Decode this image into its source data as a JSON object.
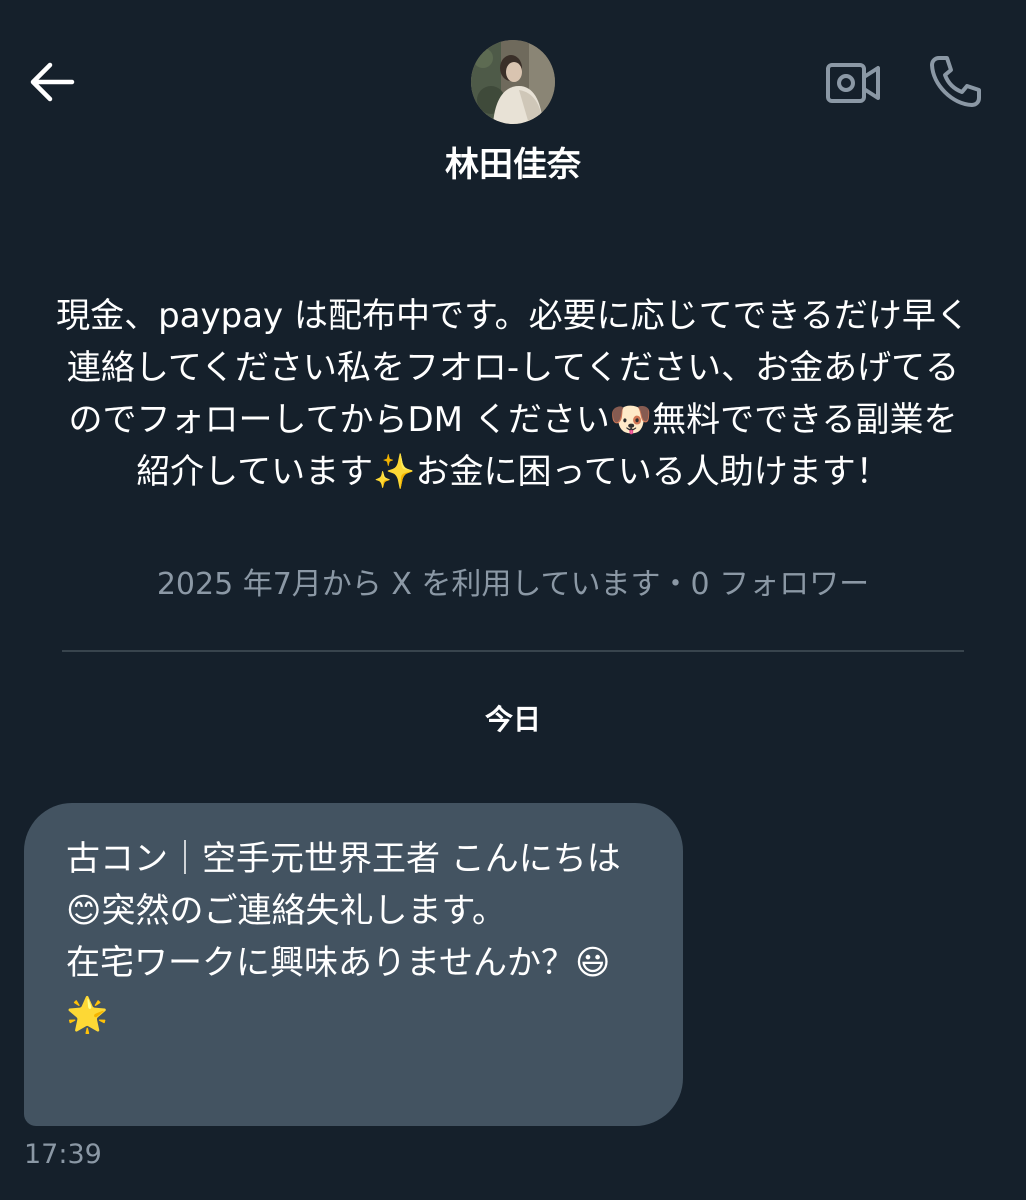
{
  "header": {
    "display_name": "林田佳奈",
    "icons": {
      "back": "arrow-left-icon",
      "video": "video-camera-icon",
      "call": "phone-icon"
    }
  },
  "profile": {
    "bio": "現金、paypay は配布中です。必要に応じてできるだけ早く連絡してください私をフオロ-してください、お金あげてるのでフォローしてからDM ください🐶無料でできる副業を紹介しています✨お金に困っている人助けます！",
    "meta": "2025 年7月から X を利用しています・0 フォロワー"
  },
  "conversation": {
    "date_label": "今日",
    "messages": [
      {
        "text": "古コン｜空手元世界王者 こんにちは😊突然のご連絡失礼します。\n在宅ワークに興味ありませんか？😃🌟",
        "time": "17:39"
      }
    ]
  },
  "colors": {
    "background": "#15202b",
    "bubble": "#435361",
    "secondary_text": "#8b98a5",
    "divider": "#38444d"
  }
}
